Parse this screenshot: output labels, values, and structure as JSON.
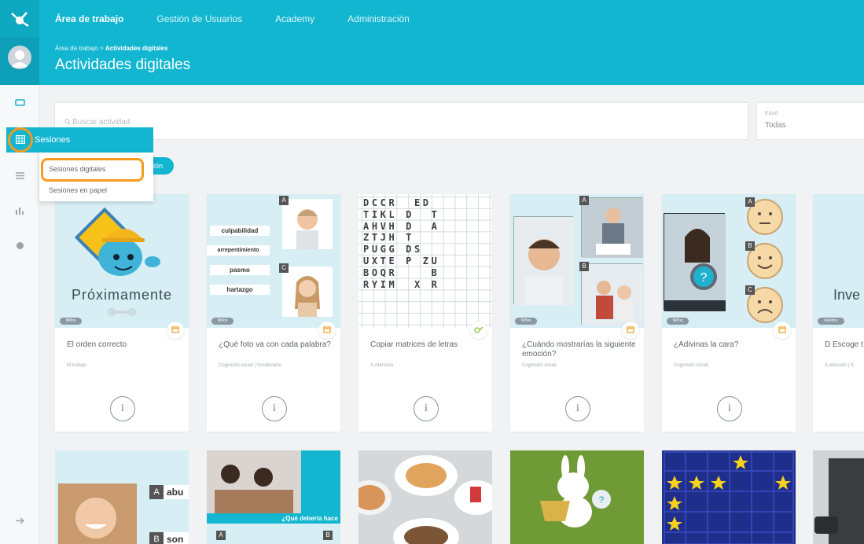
{
  "nav": {
    "items": [
      "Área de trabajo",
      "Gestión de Usuarios",
      "Academy",
      "Administración"
    ],
    "active_index": 0
  },
  "header": {
    "breadcrumb_root": "Área de trabajo",
    "breadcrumb_sep": ">",
    "breadcrumb_current": "Actividades digitales",
    "title": "Actividades digitales"
  },
  "sidebar": {
    "sesiones_label": "Sesiones",
    "submenu": [
      "Sesiones digitales",
      "Sesiones en papel"
    ],
    "pill_partial": "ión"
  },
  "search": {
    "placeholder": "Buscar actividad"
  },
  "filter": {
    "label": "Edad",
    "value": "Todas"
  },
  "cards": [
    {
      "title": "El orden correcto",
      "meta": "M.trabajo",
      "badge": "Niños",
      "thumb_text": "Próximamente"
    },
    {
      "title": "¿Qué foto va con cada palabra?",
      "meta": "Cognición social | Vocabulario",
      "badge": "Niños",
      "words": [
        "culpabilidad",
        "arrepentimiento",
        "pasmo",
        "hartazgo"
      ],
      "letters": [
        "A",
        "C"
      ]
    },
    {
      "title": "Copiar matrices de letras",
      "meta": "A.Atención",
      "badge": "",
      "grid": "DCCR  ED\nTIKL D  T\nAHVH D  A\nZTJH T\nPUGG DS\nUXTE P ZU\nBOQR    B\nRYIM  X R"
    },
    {
      "title": "¿Cuándo mostrarías la siguiente emoción?",
      "meta": "Cognición social",
      "badge": "Niños",
      "letters": [
        "A",
        "B"
      ]
    },
    {
      "title": "¿Adivinas la cara?",
      "meta": "Cognición social",
      "badge": "Niños",
      "letters": [
        "A",
        "B",
        "C"
      ]
    },
    {
      "title": "D Escoge t favoritas",
      "meta": "A.atención | E",
      "badge": "Adultos",
      "thumb_text": "Inve"
    }
  ],
  "row2": [
    {
      "words": [
        "abu",
        "son"
      ],
      "letters": [
        "A",
        "B"
      ]
    },
    {
      "caption": "¿Qué debería hace",
      "letters": [
        "A",
        "B"
      ]
    },
    {},
    {},
    {},
    {}
  ],
  "colors": {
    "primary": "#12b6d0",
    "highlight": "#f59b1e",
    "card_bg": "#d7eef4"
  }
}
